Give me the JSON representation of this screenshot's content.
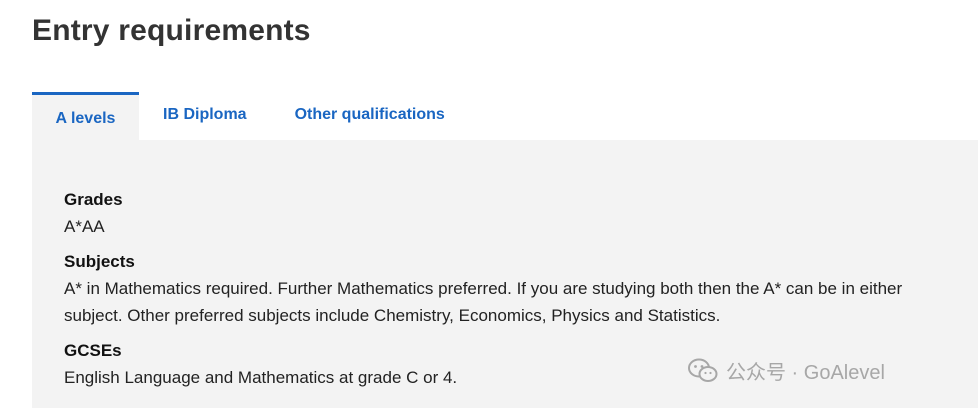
{
  "page": {
    "title": "Entry requirements"
  },
  "tabs": [
    {
      "label": "A levels",
      "active": true
    },
    {
      "label": "IB Diploma",
      "active": false
    },
    {
      "label": "Other qualifications",
      "active": false
    }
  ],
  "sections": {
    "grades": {
      "heading": "Grades",
      "text": "A*AA"
    },
    "subjects": {
      "heading": "Subjects",
      "text": "A* in Mathematics required. Further Mathematics preferred. If you are studying both then the A* can be in either subject. Other preferred subjects include Chemistry, Economics, Physics and Statistics."
    },
    "gcses": {
      "heading": "GCSEs",
      "text": "English Language and Mathematics at grade C or 4."
    }
  },
  "watermark": {
    "text": "公众号 · GoAlevel",
    "icon": "wechat-icon"
  },
  "colors": {
    "accent": "#1a66c2",
    "panel_bg": "#f3f3f3",
    "title": "#333333"
  }
}
